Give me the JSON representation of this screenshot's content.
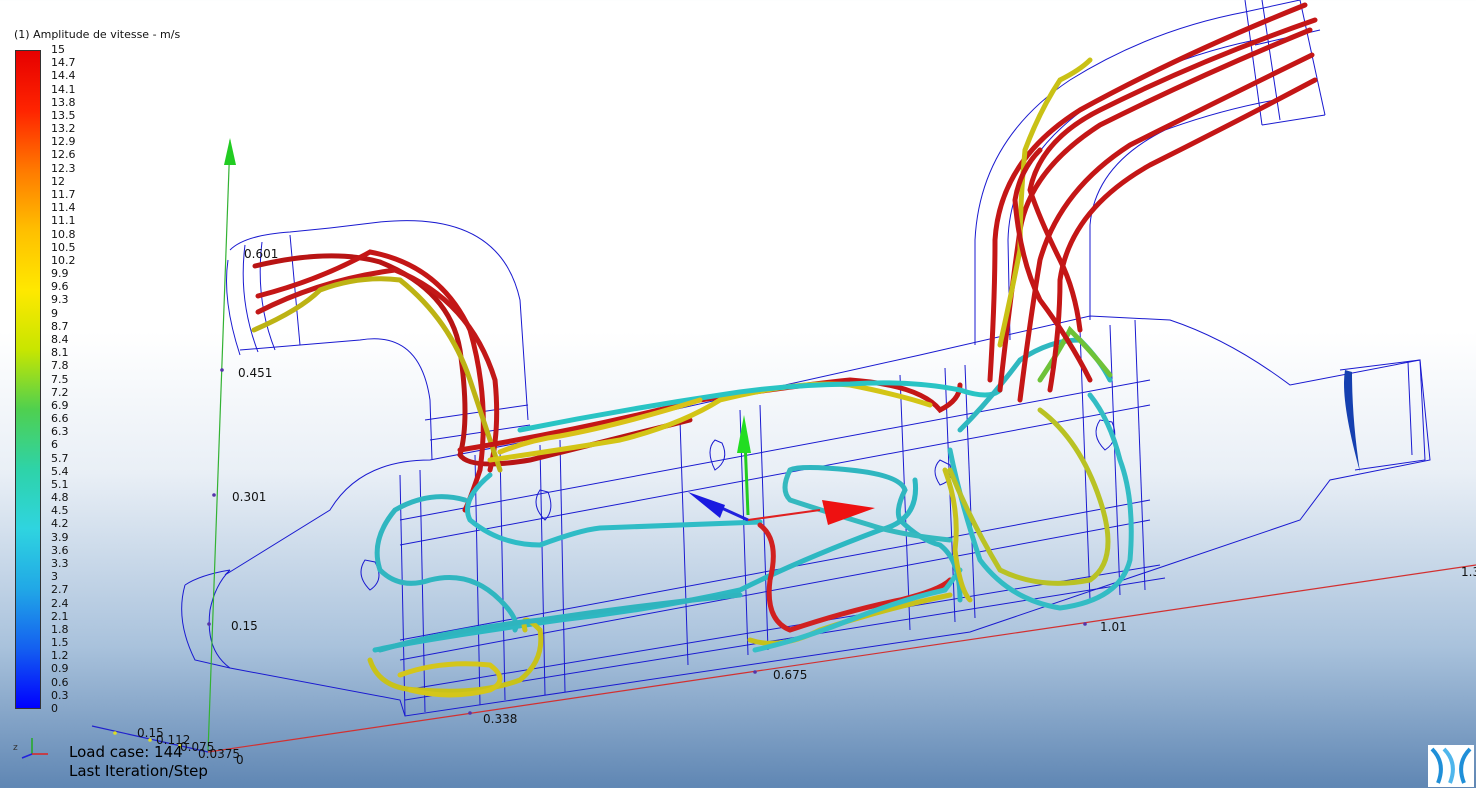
{
  "legend": {
    "title": "(1) Amplitude de vitesse - m/s",
    "labels": [
      "15",
      "14.7",
      "14.4",
      "14.1",
      "13.8",
      "13.5",
      "13.2",
      "12.9",
      "12.6",
      "12.3",
      "12",
      "11.7",
      "11.4",
      "11.1",
      "10.8",
      "10.5",
      "10.2",
      "9.9",
      "9.6",
      "9.3",
      "9",
      "8.7",
      "8.4",
      "8.1",
      "7.8",
      "7.5",
      "7.2",
      "6.9",
      "6.6",
      "6.3",
      "6",
      "5.7",
      "5.4",
      "5.1",
      "4.8",
      "4.5",
      "4.2",
      "3.9",
      "3.6",
      "3.3",
      "3",
      "2.7",
      "2.4",
      "2.1",
      "1.8",
      "1.5",
      "1.2",
      "0.9",
      "0.6",
      "0.3",
      "0"
    ],
    "colors": [
      "#e60000",
      "#ff2400",
      "#ff7a00",
      "#ffbf00",
      "#ffe800",
      "#c8e600",
      "#4fd04f",
      "#2ed3a8",
      "#2fd4e0",
      "#21a8e6",
      "#1460f0",
      "#0000ff"
    ]
  },
  "axes": {
    "vertical_ticks": [
      "0.451",
      "0.301",
      "0.15"
    ],
    "vertical_top_tick": "0.601",
    "horizontal_ticks": [
      "0.338",
      "0.675",
      "1.01",
      "1.3"
    ],
    "depth_ticks": [
      "0.15",
      "0.112",
      "0.075",
      "0.0375",
      "0"
    ]
  },
  "status": {
    "load_case": "Load case: 144",
    "step": "Last Iteration/Step"
  }
}
